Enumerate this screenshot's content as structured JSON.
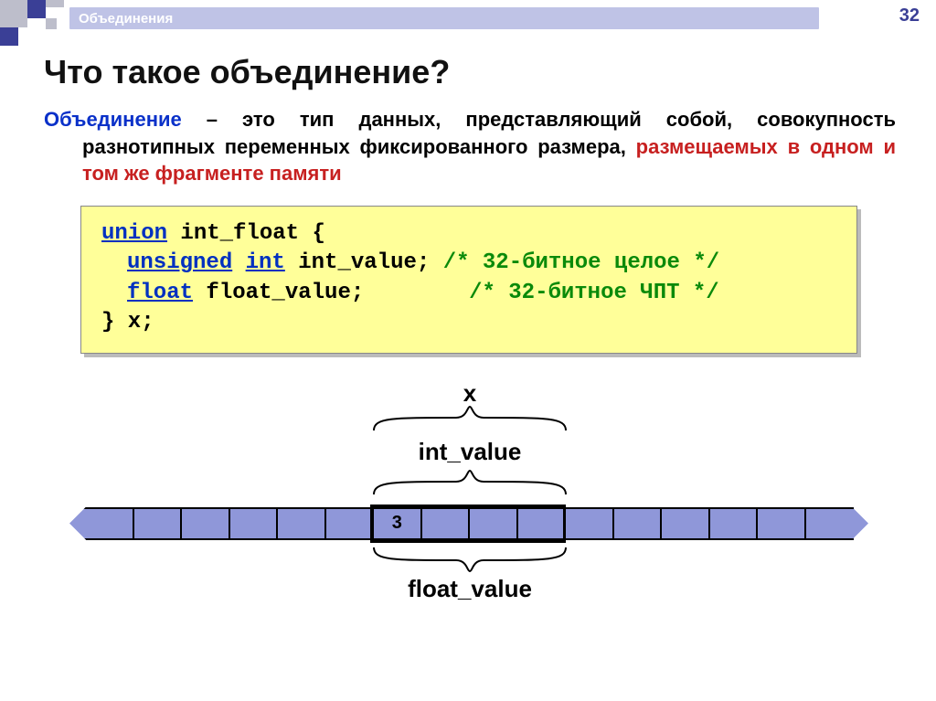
{
  "header": {
    "breadcrumb": "Объединения",
    "slide_number": "32"
  },
  "title": "Что такое объединение?",
  "definition": {
    "term": "Объединение",
    "plain1": " – это тип данных, представляющий собой, совокупность разнотипных переменных фиксированного размера, ",
    "highlight": "размещаемых в одном и том же фрагменте памяти"
  },
  "code": {
    "l1_kw": "union",
    "l1_rest": " int_float {",
    "l2_kw1": "unsigned",
    "l2_kw2": "int",
    "l2_rest": " int_value;",
    "l2_comment": "/* 32-битное целое */",
    "l3_kw": "float",
    "l3_rest": " float_value;",
    "l3_comment": "/* 32-битное ЧПТ */",
    "l4": "} x;"
  },
  "diagram": {
    "x": "x",
    "int_label": "int_value",
    "float_label": "float_value",
    "cell_value": "3"
  }
}
